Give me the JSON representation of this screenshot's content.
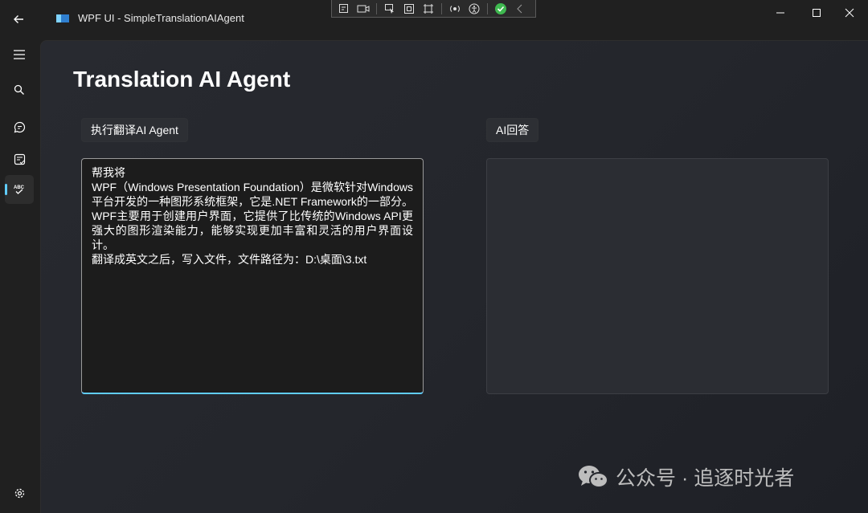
{
  "window": {
    "title": "WPF UI - SimpleTranslationAIAgent"
  },
  "page": {
    "title": "Translation AI Agent",
    "run_button_label": "执行翻译AI Agent",
    "ai_answer_label": "AI回答",
    "input_text": "帮我将\nWPF（Windows Presentation Foundation）是微软针对Windows平台开发的一种图形系统框架，它是.NET Framework的一部分。WPF主要用于创建用户界面，它提供了比传统的Windows API更强大的图形渲染能力，能够实现更加丰富和灵活的用户界面设计。\n翻译成英文之后，写入文件，文件路径为：D:\\桌面\\3.txt",
    "ai_answer_text": ""
  },
  "nav": {
    "items": [
      "menu-icon",
      "search-icon",
      "chat-icon",
      "checklist-icon",
      "spellcheck-icon"
    ],
    "active": "spellcheck-icon",
    "footer": "settings-icon"
  },
  "watermark": {
    "text": "公众号 · 追逐时光者"
  },
  "colors": {
    "accent": "#60cdff",
    "background": "#202020",
    "content_bg": "#26282e"
  }
}
